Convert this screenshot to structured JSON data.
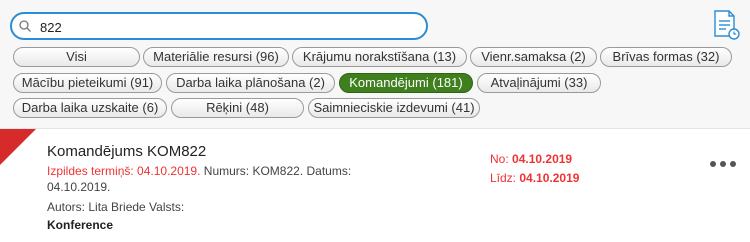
{
  "search": {
    "value": "822"
  },
  "filters": [
    {
      "label": "Visi"
    },
    {
      "label": "Materiālie resursi (96)"
    },
    {
      "label": "Krājumu norakstīšana (13)"
    },
    {
      "label": "Vienr.samaksa (2)"
    },
    {
      "label": "Brīvas formas (32)"
    },
    {
      "label": "Mācību pieteikumi (91)"
    },
    {
      "label": "Darba laika plānošana (2)"
    },
    {
      "label": "Komandējumi (181)",
      "selected": true
    },
    {
      "label": "Atvaļinājumi (33)"
    },
    {
      "label": "Darba laika uzskaite (6)"
    },
    {
      "label": "Rēķini (48)"
    },
    {
      "label": "Saimnieciskie izdevumi (41)"
    }
  ],
  "item": {
    "title": "Komandējums KOM822",
    "deadline_label": "Izpildes termiņš:",
    "deadline_value": "04.10.2019",
    "number_text": "Numurs: KOM822. Datums:",
    "date_value": "04.10.2019.",
    "author": "Autors: Lita Briede Valsts:",
    "purpose": "Konference",
    "from_label": "No:",
    "from_value": "04.10.2019",
    "to_label": "Līdz:",
    "to_value": "04.10.2019"
  },
  "icons": {
    "search": "search-icon",
    "report": "document-report-icon",
    "more": "more-options-icon"
  },
  "colors": {
    "accent_blue": "#2a8dd6",
    "active_chip": "#3f7f1e",
    "alert_red": "#d52b2b"
  }
}
